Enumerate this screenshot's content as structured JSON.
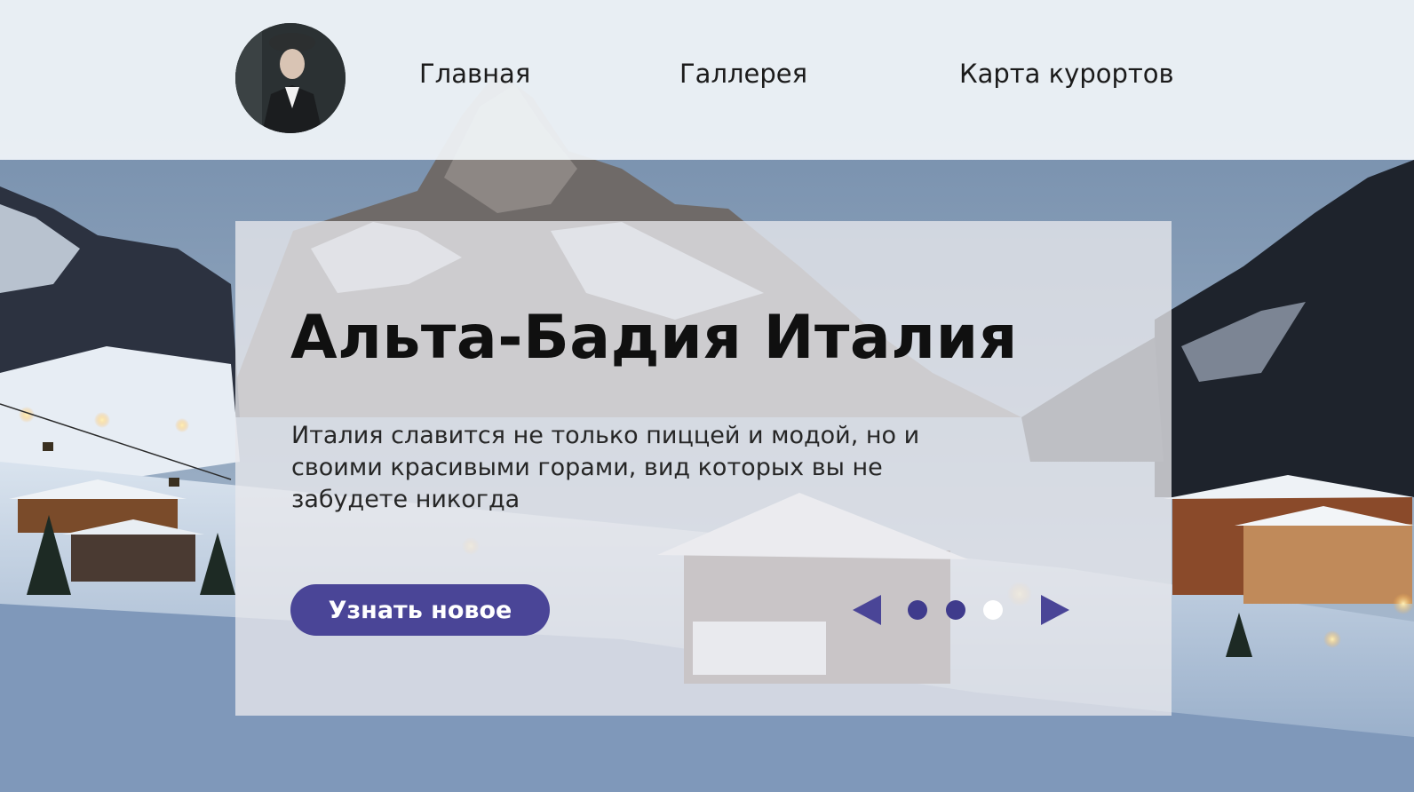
{
  "colors": {
    "accent": "#4a4597",
    "dot_inactive": "#3f3b8c",
    "dot_active": "#ffffff",
    "header_bg": "#f1f5f9",
    "text_dark": "#101010"
  },
  "header": {
    "avatar_icon": "user-avatar-icon",
    "nav": [
      {
        "label": "Главная"
      },
      {
        "label": "Галлерея"
      },
      {
        "label": "Карта курортов"
      }
    ]
  },
  "hero": {
    "title": "Альта-Бадия Италия",
    "description": "Италия славится не только пиццей и модой, но и своими красивыми горами, вид которых вы не забудете никогда",
    "cta_label": "Узнать новое"
  },
  "slider": {
    "prev_icon": "triangle-left-icon",
    "next_icon": "triangle-right-icon",
    "slide_count": 3,
    "active_index": 3
  }
}
